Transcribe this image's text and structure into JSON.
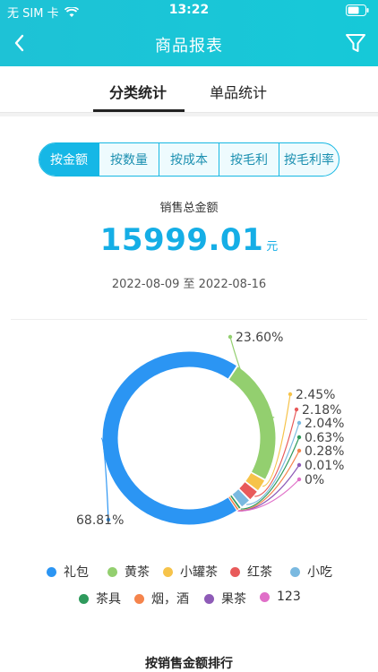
{
  "status": {
    "carrier": "无 SIM 卡",
    "time": "13:22"
  },
  "nav": {
    "title": "商品报表"
  },
  "tabs": [
    {
      "label": "分类统计"
    },
    {
      "label": "单品统计"
    }
  ],
  "segments": [
    "按金额",
    "按数量",
    "按成本",
    "按毛利",
    "按毛利率"
  ],
  "summary": {
    "label": "销售总金额",
    "value": "15999.01",
    "unit": "元",
    "date_range": "2022-08-09 至 2022-08-16"
  },
  "colors": {
    "accent": "#16b7e6"
  },
  "chart_data": {
    "type": "pie",
    "variant": "donut",
    "categories": [
      "礼包",
      "黄茶",
      "小罐茶",
      "红茶",
      "小吃",
      "茶具",
      "烟，酒",
      "果茶",
      "123"
    ],
    "values": [
      68.81,
      23.6,
      2.45,
      2.18,
      2.04,
      0.63,
      0.28,
      0.01,
      0
    ],
    "labels": [
      "68.81%",
      "23.60%",
      "2.45%",
      "2.18%",
      "2.04%",
      "0.63%",
      "0.28%",
      "0.01%",
      "0%"
    ],
    "colors": [
      "#2b95f3",
      "#93cf6f",
      "#f6c34a",
      "#e85a5a",
      "#7ab9e0",
      "#2e9a5c",
      "#f5844c",
      "#8e5bb7",
      "#e06fc8"
    ],
    "legend_position": "bottom"
  },
  "next_section": {
    "title": "按销售金额排行"
  }
}
